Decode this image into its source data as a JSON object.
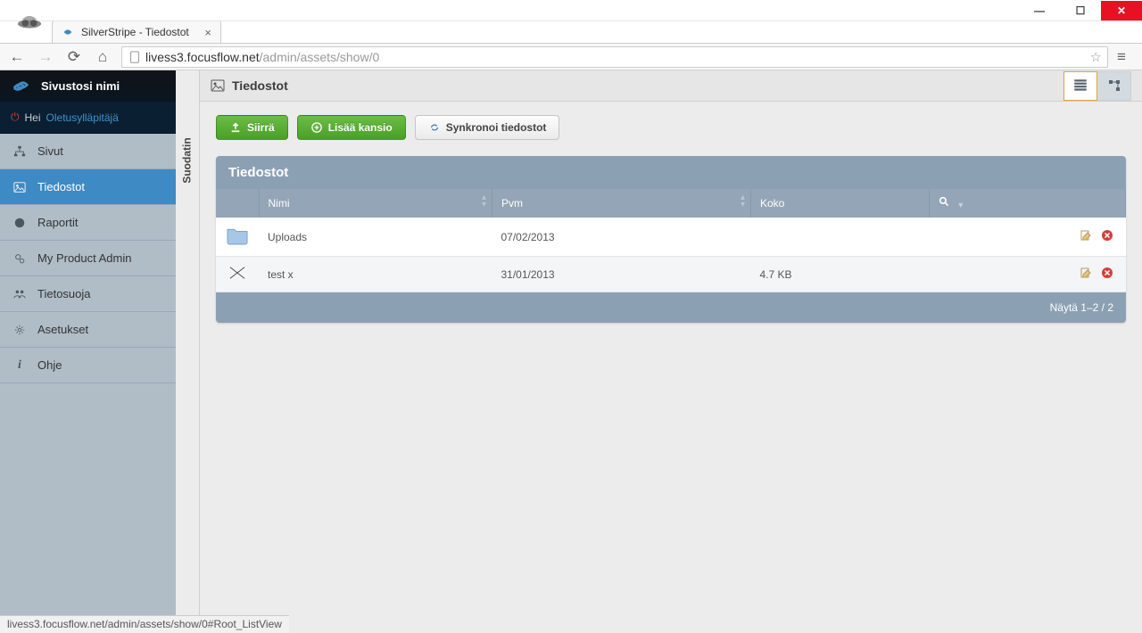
{
  "browser": {
    "tab_title": "SilverStripe - Tiedostot",
    "url_host": "livess3.focusflow.net",
    "url_path": "/admin/assets/show/0",
    "status_bar": "livess3.focusflow.net/admin/assets/show/0#Root_ListView"
  },
  "sidebar": {
    "site_name": "Sivustosi nimi",
    "greeting_prefix": "Hei",
    "greeting_user": "Oletusylläpitäjä",
    "items": [
      {
        "label": "Sivut",
        "icon": "sitemap"
      },
      {
        "label": "Tiedostot",
        "icon": "image",
        "active": true
      },
      {
        "label": "Raportit",
        "icon": "globe"
      },
      {
        "label": "My Product Admin",
        "icon": "gears"
      },
      {
        "label": "Tietosuoja",
        "icon": "people"
      },
      {
        "label": "Asetukset",
        "icon": "gear"
      },
      {
        "label": "Ohje",
        "icon": "info"
      }
    ]
  },
  "filter": {
    "label": "Suodatin"
  },
  "main": {
    "title": "Tiedostot",
    "buttons": {
      "upload": "Siirrä",
      "add_folder": "Lisää kansio",
      "sync": "Synkronoi tiedostot"
    },
    "grid": {
      "title": "Tiedostot",
      "columns": {
        "name": "Nimi",
        "date": "Pvm",
        "size": "Koko"
      },
      "rows": [
        {
          "type": "folder",
          "name": "Uploads",
          "date": "07/02/2013",
          "size": ""
        },
        {
          "type": "file",
          "name": "test x",
          "date": "31/01/2013",
          "size": "4.7 KB"
        }
      ],
      "footer": "Näytä 1–2 / 2"
    }
  }
}
